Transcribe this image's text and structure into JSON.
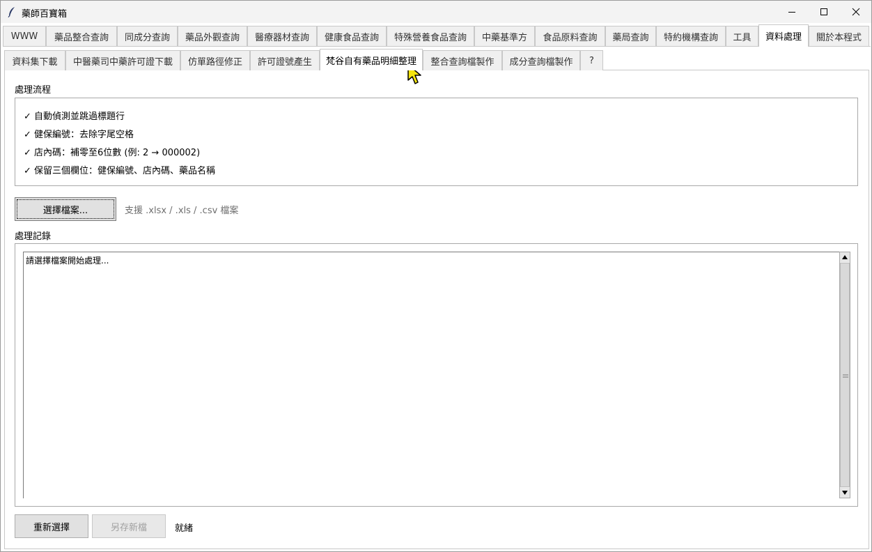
{
  "window": {
    "title": "藥師百寶箱",
    "icons": {
      "app": "feather-icon",
      "minimize": "minimize-icon",
      "maximize": "maximize-icon",
      "close": "close-icon"
    }
  },
  "main_tabs": [
    {
      "label": "WWW",
      "active": false
    },
    {
      "label": "藥品整合查詢",
      "active": false
    },
    {
      "label": "同成分查詢",
      "active": false
    },
    {
      "label": "藥品外觀查詢",
      "active": false
    },
    {
      "label": "醫療器材查詢",
      "active": false
    },
    {
      "label": "健康食品查詢",
      "active": false
    },
    {
      "label": "特殊營養食品查詢",
      "active": false
    },
    {
      "label": "中藥基準方",
      "active": false
    },
    {
      "label": "食品原料查詢",
      "active": false
    },
    {
      "label": "藥局查詢",
      "active": false
    },
    {
      "label": "特約機構查詢",
      "active": false
    },
    {
      "label": "工具",
      "active": false
    },
    {
      "label": "資料處理",
      "active": true
    },
    {
      "label": "關於本程式",
      "active": false
    }
  ],
  "sub_tabs": [
    {
      "label": "資料集下載",
      "active": false
    },
    {
      "label": "中醫藥司中藥許可證下載",
      "active": false
    },
    {
      "label": "仿單路徑修正",
      "active": false
    },
    {
      "label": "許可證號產生",
      "active": false
    },
    {
      "label": "梵谷自有藥品明細整理",
      "active": true
    },
    {
      "label": "整合查詢檔製作",
      "active": false
    },
    {
      "label": "成分查詢檔製作",
      "active": false
    },
    {
      "label": "?",
      "active": false
    }
  ],
  "process": {
    "label": "處理流程",
    "items": [
      "✓ 自動偵測並跳過標題行",
      "✓ 健保編號：去除字尾空格",
      "✓ 店內碼：補零至6位數 (例: 2 → 000002)",
      "✓ 保留三個欄位：健保編號、店內碼、藥品名稱"
    ]
  },
  "file": {
    "select_label": "選擇檔案...",
    "hint": "支援 .xlsx / .xls / .csv 檔案"
  },
  "log": {
    "label": "處理記錄",
    "text": "請選擇檔案開始處理..."
  },
  "footer": {
    "reselect_label": "重新選擇",
    "save_label": "另存新檔",
    "save_enabled": false,
    "status": "就緒"
  }
}
